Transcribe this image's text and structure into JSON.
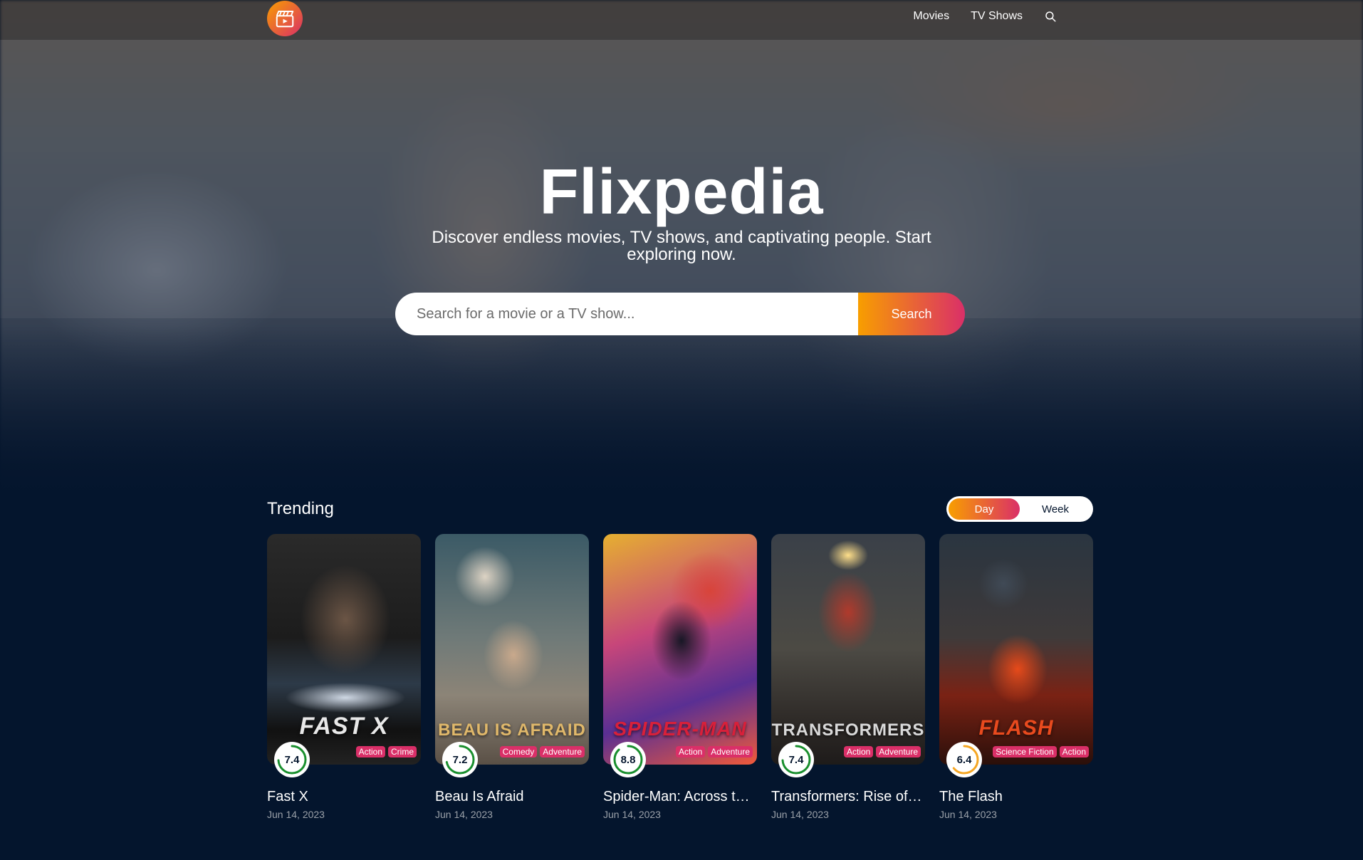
{
  "header": {
    "nav": {
      "movies": "Movies",
      "tv_shows": "TV Shows"
    }
  },
  "hero": {
    "title": "Flixpedia",
    "subtitle": "Discover endless movies, TV shows, and captivating people. Start exploring now.",
    "search_placeholder": "Search for a movie or a TV show...",
    "search_button": "Search"
  },
  "trending": {
    "title": "Trending",
    "tabs": {
      "day": "Day",
      "week": "Week"
    },
    "active_tab": "Day",
    "items": [
      {
        "title": "Fast X",
        "date": "Jun 14, 2023",
        "rating": "7.4",
        "rating_value": 7.4,
        "genres": [
          "Action",
          "Crime"
        ],
        "poster_text": "FAST X"
      },
      {
        "title": "Beau Is Afraid",
        "date": "Jun 14, 2023",
        "rating": "7.2",
        "rating_value": 7.2,
        "genres": [
          "Comedy",
          "Adventure"
        ],
        "poster_text": "BEAU IS AFRAID"
      },
      {
        "title": "Spider-Man: Across the Spider-Verse",
        "date": "Jun 14, 2023",
        "rating": "8.8",
        "rating_value": 8.8,
        "genres": [
          "Action",
          "Adventure"
        ],
        "poster_text": "SPIDER-MAN"
      },
      {
        "title": "Transformers: Rise of the Beasts",
        "date": "Jun 14, 2023",
        "rating": "7.4",
        "rating_value": 7.4,
        "genres": [
          "Action",
          "Adventure"
        ],
        "poster_text": "TRANSFORMERS"
      },
      {
        "title": "The Flash",
        "date": "Jun 14, 2023",
        "rating": "6.4",
        "rating_value": 6.4,
        "genres": [
          "Science Fiction",
          "Action"
        ],
        "poster_text": "FLASH"
      }
    ]
  },
  "colors": {
    "background": "#04152d",
    "gradient_start": "#f89e00",
    "gradient_end": "#da2f68",
    "genre_badge": "#da2f68",
    "rating_high": "#1a8f2e",
    "rating_mid": "#f5a623"
  },
  "icons": {
    "logo": "clapperboard-icon",
    "search": "search-icon"
  }
}
